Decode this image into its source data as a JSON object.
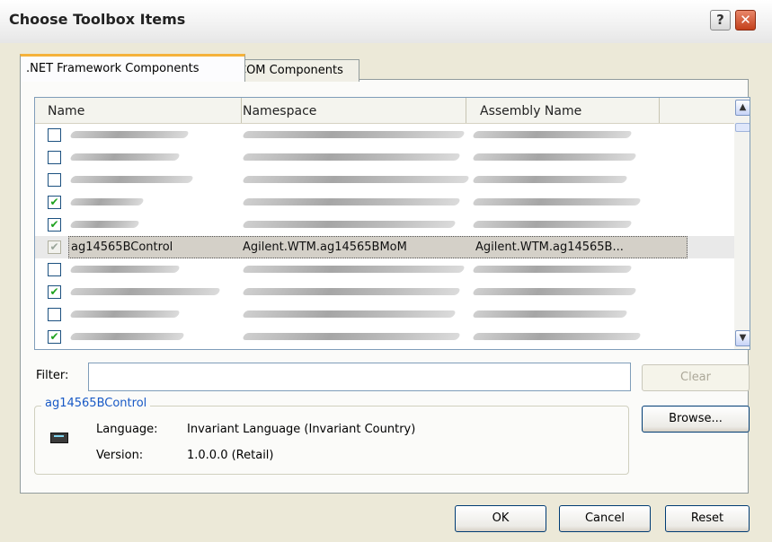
{
  "window": {
    "title": "Choose Toolbox Items",
    "help_glyph": "?",
    "close_glyph": "✕"
  },
  "tabs": [
    {
      "label": ".NET Framework Components",
      "active": true
    },
    {
      "label": "COM Components",
      "active": false
    }
  ],
  "list": {
    "columns": [
      "Name",
      "Namespace",
      "Assembly Name"
    ],
    "rows": [
      {
        "checked": false,
        "name": "",
        "namespace": "",
        "assembly": "",
        "obscured": true
      },
      {
        "checked": false,
        "name": "",
        "namespace": "",
        "assembly": "",
        "obscured": true
      },
      {
        "checked": false,
        "name": "",
        "namespace": "",
        "assembly": "",
        "obscured": true
      },
      {
        "checked": true,
        "name": "",
        "namespace": "",
        "assembly": "",
        "obscured": true
      },
      {
        "checked": true,
        "name": "",
        "namespace": "",
        "assembly": "",
        "obscured": true
      },
      {
        "checked": true,
        "name": "ag14565BControl",
        "namespace": "Agilent.WTM.ag14565BMoM",
        "assembly": "Agilent.WTM.ag14565B...",
        "obscured": false,
        "selected": true
      },
      {
        "checked": false,
        "name": "",
        "namespace": "",
        "assembly": "",
        "obscured": true
      },
      {
        "checked": true,
        "name": "",
        "namespace": "",
        "assembly": "",
        "obscured": true
      },
      {
        "checked": false,
        "name": "",
        "namespace": "",
        "assembly": "",
        "obscured": true
      },
      {
        "checked": true,
        "name": "",
        "namespace": "",
        "assembly": "",
        "obscured": true
      }
    ],
    "scroll_up_glyph": "▲",
    "scroll_down_glyph": "▼"
  },
  "filter": {
    "label": "Filter:",
    "value": "",
    "clear_label": "Clear"
  },
  "details": {
    "title": "ag14565BControl",
    "language_label": "Language:",
    "language_value": "Invariant Language (Invariant Country)",
    "version_label": "Version:",
    "version_value": "1.0.0.0 (Retail)"
  },
  "buttons": {
    "browse": "Browse...",
    "ok": "OK",
    "cancel": "Cancel",
    "reset": "Reset"
  },
  "colors": {
    "accent_tab": "#f5b23a",
    "check": "#1fa21f",
    "group_title": "#1859c6",
    "close": "#c3401b"
  }
}
